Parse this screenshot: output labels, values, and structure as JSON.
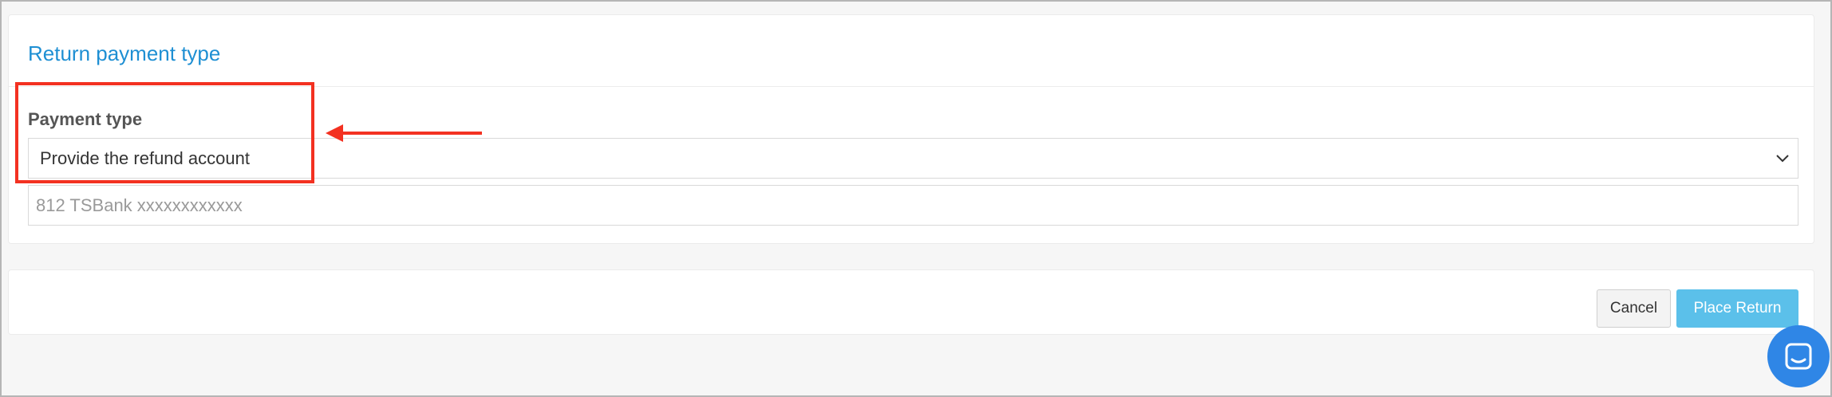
{
  "section": {
    "title": "Return payment type",
    "payment_type_label": "Payment type",
    "payment_type_selected": "Provide the refund account",
    "account_placeholder": "812 TSBank xxxxxxxxxxxx"
  },
  "actions": {
    "cancel_label": "Cancel",
    "place_return_label": "Place Return"
  },
  "icons": {
    "select_chevron": "chevron-down-icon",
    "chat": "chat-icon"
  },
  "colors": {
    "title": "#1e8fd3",
    "primary_button": "#5bc0ea",
    "annotation": "#f33121",
    "chat_bubble": "#2f86e6"
  }
}
